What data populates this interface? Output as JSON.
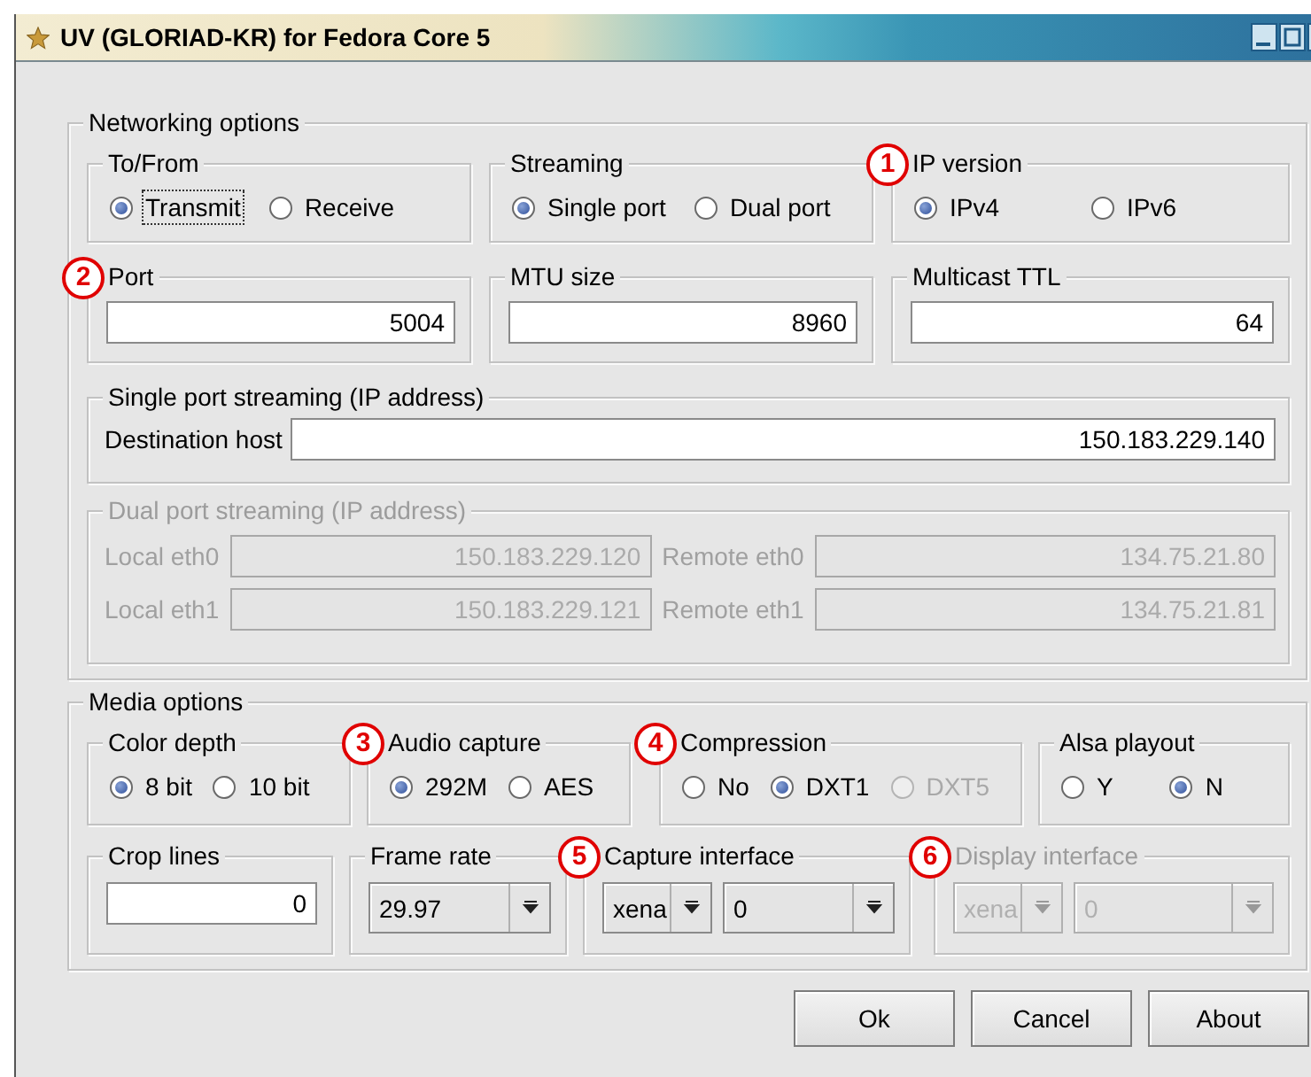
{
  "window": {
    "title": "UV (GLORIAD-KR) for Fedora Core 5"
  },
  "networking": {
    "title": "Networking options",
    "choices": [
      {
        "title": "To/From",
        "options": [
          {
            "label": "Transmit",
            "selected": true,
            "focused": true,
            "disabled": false
          },
          {
            "label": "Receive",
            "selected": false,
            "focused": false,
            "disabled": false
          }
        ]
      },
      {
        "title": "Streaming",
        "options": [
          {
            "label": "Single port",
            "selected": true,
            "focused": false,
            "disabled": false
          },
          {
            "label": "Dual port",
            "selected": false,
            "focused": false,
            "disabled": false
          }
        ]
      },
      {
        "title": "IP version",
        "marker": "1",
        "options": [
          {
            "label": "IPv4",
            "selected": true,
            "focused": false,
            "disabled": false
          },
          {
            "label": "IPv6",
            "selected": false,
            "focused": false,
            "disabled": false
          }
        ]
      }
    ],
    "numbers": [
      {
        "title": "Port",
        "marker": "2",
        "value": "5004"
      },
      {
        "title": "MTU size",
        "value": "8960"
      },
      {
        "title": "Multicast TTL",
        "value": "64"
      }
    ],
    "single_port": {
      "title": "Single port streaming (IP address)",
      "label": "Destination host",
      "value": "150.183.229.140"
    },
    "dual_port": {
      "title": "Dual port streaming (IP address)",
      "disabled": true,
      "rows": [
        {
          "local_label": "Local eth0",
          "local_value": "150.183.229.120",
          "remote_label": "Remote eth0",
          "remote_value": "134.75.21.80"
        },
        {
          "local_label": "Local eth1",
          "local_value": "150.183.229.121",
          "remote_label": "Remote eth1",
          "remote_value": "134.75.21.81"
        }
      ]
    }
  },
  "media": {
    "title": "Media options",
    "choices": [
      {
        "title": "Color depth",
        "options": [
          {
            "label": "8 bit",
            "selected": true,
            "focused": false,
            "disabled": false
          },
          {
            "label": "10 bit",
            "selected": false,
            "focused": false,
            "disabled": false
          }
        ]
      },
      {
        "title": "Audio capture",
        "marker": "3",
        "options": [
          {
            "label": "292M",
            "selected": true,
            "focused": false,
            "disabled": false
          },
          {
            "label": "AES",
            "selected": false,
            "focused": false,
            "disabled": false
          }
        ]
      },
      {
        "title": "Compression",
        "marker": "4",
        "options": [
          {
            "label": "No",
            "selected": false,
            "focused": false,
            "disabled": false
          },
          {
            "label": "DXT1",
            "selected": true,
            "focused": false,
            "disabled": false
          },
          {
            "label": "DXT5",
            "selected": false,
            "focused": false,
            "disabled": true
          }
        ]
      },
      {
        "title": "Alsa playout",
        "options": [
          {
            "label": "Y",
            "selected": false,
            "focused": false,
            "disabled": false
          },
          {
            "label": "N",
            "selected": true,
            "focused": false,
            "disabled": false
          }
        ]
      }
    ],
    "settings": [
      {
        "title": "Crop lines",
        "kind": "field",
        "disabled": false,
        "values": [
          "0"
        ]
      },
      {
        "title": "Frame rate",
        "kind": "combo",
        "disabled": false,
        "values": [
          "29.97"
        ]
      },
      {
        "title": "Capture interface",
        "marker": "5",
        "kind": "combo",
        "disabled": false,
        "values": [
          "xena",
          "0"
        ]
      },
      {
        "title": "Display interface",
        "marker": "6",
        "kind": "combo",
        "disabled": true,
        "values": [
          "xena",
          "0"
        ]
      }
    ]
  },
  "buttons": [
    "Ok",
    "Cancel",
    "About"
  ]
}
